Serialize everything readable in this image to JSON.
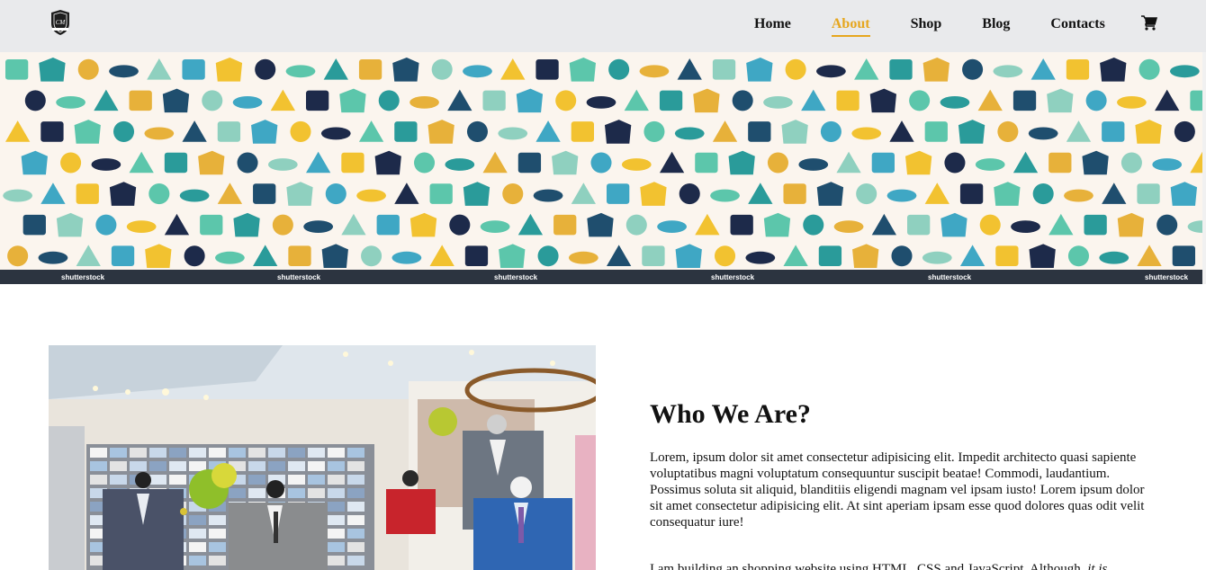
{
  "nav": {
    "logo_icon": "shield-crest-logo",
    "links": [
      {
        "label": "Home",
        "active": false
      },
      {
        "label": "About",
        "active": true
      },
      {
        "label": "Shop",
        "active": false
      },
      {
        "label": "Blog",
        "active": false
      },
      {
        "label": "Contacts",
        "active": false
      }
    ],
    "cart_icon": "shopping-cart-icon",
    "accent_color": "#e6a61d"
  },
  "banner": {
    "watermark": "shutterstock",
    "background": "#fbf5ee"
  },
  "about": {
    "title": "Who We Are?",
    "paragraph1": "Lorem, ipsum dolor sit amet consectetur adipisicing elit. Impedit architecto quasi sapiente voluptatibus magni voluptatum consequuntur suscipit beatae! Commodi, laudantium. Possimus soluta sit aliquid, blanditiis eligendi magnam vel ipsam iusto! Lorem ipsum dolor sit amet consectetur adipisicing elit. At sint aperiam ipsam esse quod dolores quas odit velit consequatur iure!",
    "paragraph2_start": "I am building an shopping website using HTML, CSS and JavaScript. Although,",
    "paragraph2_em": "it is"
  }
}
